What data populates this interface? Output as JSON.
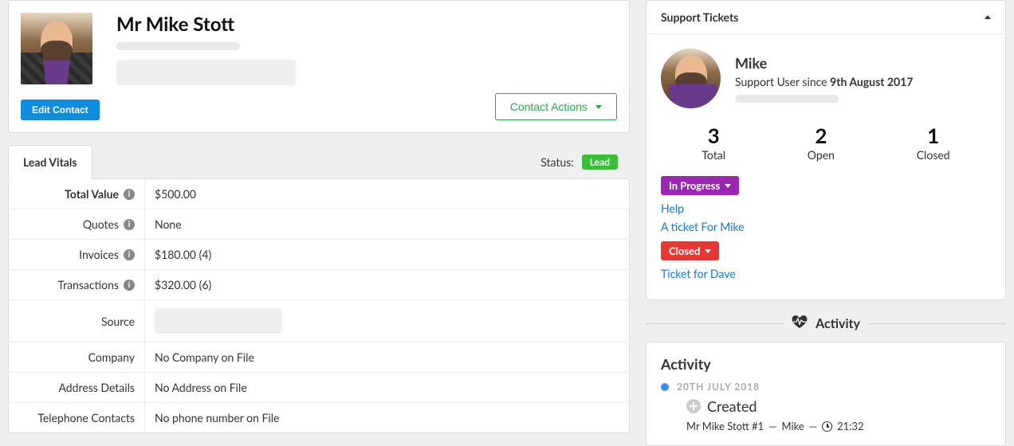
{
  "profile": {
    "name": "Mr Mike Stott",
    "edit_button": "Edit Contact",
    "contact_actions": "Contact Actions"
  },
  "tabs": {
    "lead_vitals": "Lead Vitals",
    "status_label": "Status:",
    "status_badge": "Lead"
  },
  "vitals": {
    "total_value": {
      "label": "Total Value",
      "value": "$500.00"
    },
    "quotes": {
      "label": "Quotes",
      "value": "None"
    },
    "invoices": {
      "label": "Invoices",
      "value": "$180.00 (4)"
    },
    "transactions": {
      "label": "Transactions",
      "value": "$320.00 (6)"
    },
    "source": {
      "label": "Source"
    },
    "company": {
      "label": "Company",
      "value": "No Company on File"
    },
    "address": {
      "label": "Address Details",
      "value": "No Address on File"
    },
    "phone": {
      "label": "Telephone Contacts",
      "value": "No phone number on File"
    }
  },
  "support": {
    "panel_title": "Support Tickets",
    "user_name": "Mike",
    "since_prefix": "Support User since ",
    "since_date": "9th August 2017",
    "stats": {
      "total": {
        "num": "3",
        "label": "Total"
      },
      "open": {
        "num": "2",
        "label": "Open"
      },
      "closed": {
        "num": "1",
        "label": "Closed"
      }
    },
    "in_progress_badge": "In Progress",
    "in_progress_tickets": [
      "Help",
      "A ticket For Mike"
    ],
    "closed_badge": "Closed",
    "closed_tickets": [
      "Ticket for Dave"
    ]
  },
  "activity": {
    "divider_label": "Activity",
    "panel_title": "Activity",
    "date": "20TH JULY 2018",
    "event_title": "Created",
    "event_meta_contact": "Mr Mike Stott #1",
    "event_meta_user": "Mike",
    "event_time": "21:32"
  }
}
